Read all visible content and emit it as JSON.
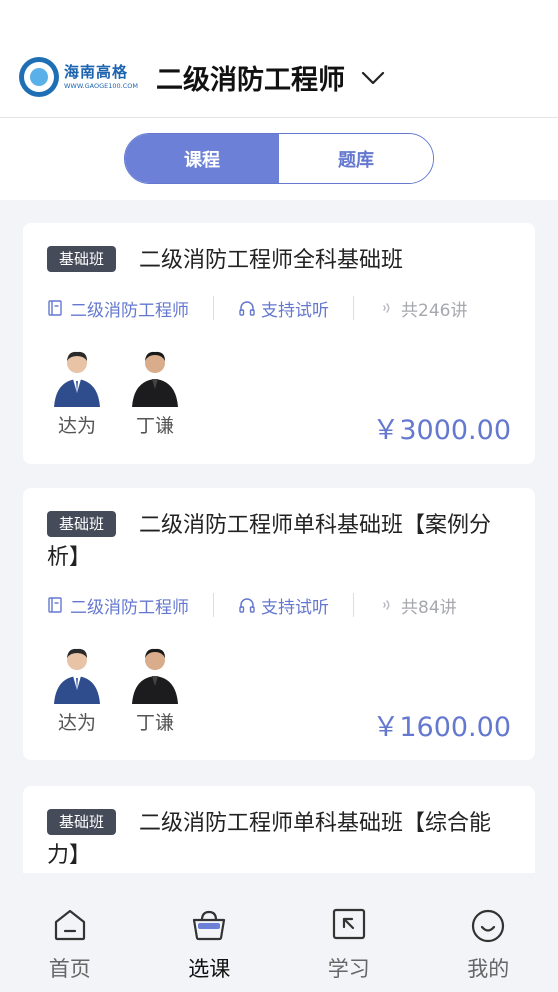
{
  "header": {
    "logo_cn": "海南高格",
    "logo_en": "WWW.GAOGE100.COM",
    "title": "二级消防工程师"
  },
  "segment": {
    "tabs": [
      {
        "label": "课程",
        "active": true
      },
      {
        "label": "题库",
        "active": false
      }
    ]
  },
  "courses": [
    {
      "badge": "基础班",
      "title": "二级消防工程师全科基础班",
      "category": "二级消防工程师",
      "trial": "支持试听",
      "lessons": "共246讲",
      "teachers": [
        "达为",
        "丁谦"
      ],
      "price": "￥3000.00"
    },
    {
      "badge": "基础班",
      "title": "二级消防工程师单科基础班【案例分析】",
      "category": "二级消防工程师",
      "trial": "支持试听",
      "lessons": "共84讲",
      "teachers": [
        "达为",
        "丁谦"
      ],
      "price": "￥1600.00"
    },
    {
      "badge": "基础班",
      "title": "二级消防工程师单科基础班【综合能力】"
    }
  ],
  "tabbar": {
    "items": [
      {
        "label": "首页",
        "icon": "home-icon"
      },
      {
        "label": "选课",
        "icon": "basket-icon"
      },
      {
        "label": "学习",
        "icon": "study-icon"
      },
      {
        "label": "我的",
        "icon": "smile-icon"
      }
    ],
    "active_index": 1
  },
  "colors": {
    "accent": "#6478cf",
    "badge_bg": "#454b59",
    "background": "#f3f4f7"
  }
}
